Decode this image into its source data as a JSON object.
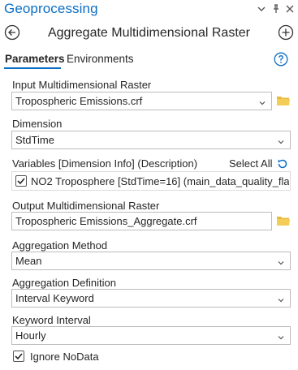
{
  "pane": {
    "title": "Geoprocessing"
  },
  "tool": {
    "title": "Aggregate Multidimensional Raster"
  },
  "tabs": {
    "parameters": "Parameters",
    "environments": "Environments"
  },
  "params": {
    "input_raster": {
      "label": "Input Multidimensional Raster",
      "value": "Tropospheric Emissions.crf"
    },
    "dimension": {
      "label": "Dimension",
      "value": "StdTime"
    },
    "variables": {
      "label": "Variables [Dimension Info] (Description)",
      "select_all": "Select All",
      "items": [
        {
          "checked": true,
          "text": "NO2 Troposphere [StdTime=16] (main_data_quality_flag..."
        }
      ]
    },
    "output_raster": {
      "label": "Output Multidimensional Raster",
      "value": "Tropospheric Emissions_Aggregate.crf"
    },
    "aggregation_method": {
      "label": "Aggregation Method",
      "value": "Mean"
    },
    "aggregation_definition": {
      "label": "Aggregation Definition",
      "value": "Interval Keyword"
    },
    "keyword_interval": {
      "label": "Keyword Interval",
      "value": "Hourly"
    },
    "ignore_nodata": {
      "checked": true,
      "label": "Ignore NoData"
    }
  },
  "icons": {
    "accent": "#0b6ec5",
    "folder": "#f0c040",
    "header_menu": "chevron-down-icon",
    "header_pin": "pin-icon",
    "header_close": "close-icon",
    "back": "back-arrow-icon",
    "add": "add-icon",
    "help": "help-icon",
    "reset": "reset-icon"
  }
}
